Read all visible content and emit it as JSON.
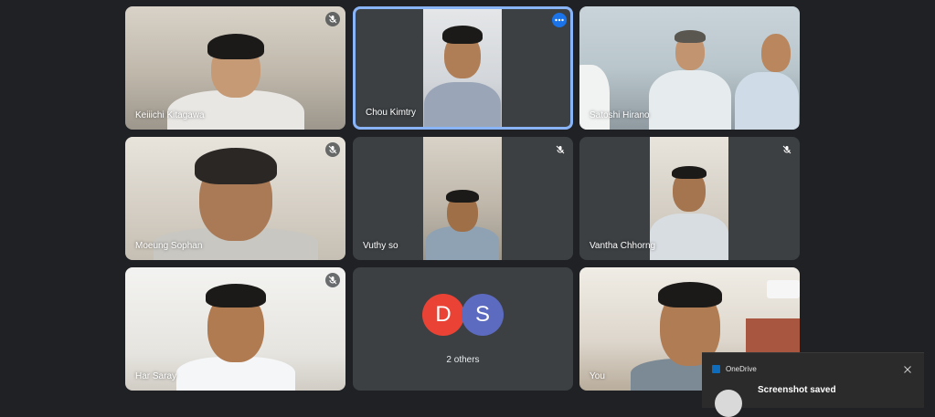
{
  "participants": [
    {
      "name": "Keiiichi Kitagawa",
      "muted": true
    },
    {
      "name": "Chou Kimtry",
      "muted": false,
      "active": true
    },
    {
      "name": "Satoshi Hirano",
      "muted": false
    },
    {
      "name": "Moeung Sophan",
      "muted": true
    },
    {
      "name": "Vuthy so",
      "muted": true
    },
    {
      "name": "Vantha Chhorng",
      "muted": true
    },
    {
      "name": "Har Saray",
      "muted": true
    },
    {
      "name": "You",
      "muted": false
    }
  ],
  "others": {
    "avatars": [
      {
        "letter": "D",
        "color": "#ea4335"
      },
      {
        "letter": "S",
        "color": "#5c6bc0"
      }
    ],
    "label": "2 others"
  },
  "toast": {
    "app": "OneDrive",
    "title": "Screenshot saved"
  },
  "colors": {
    "background": "#202124",
    "tile": "#3c4043",
    "active_border": "#8ab4f8",
    "accent": "#1a73e8"
  },
  "icons": {
    "mic_off": "mic-off-icon",
    "more": "more-options-icon",
    "close": "close-icon"
  }
}
